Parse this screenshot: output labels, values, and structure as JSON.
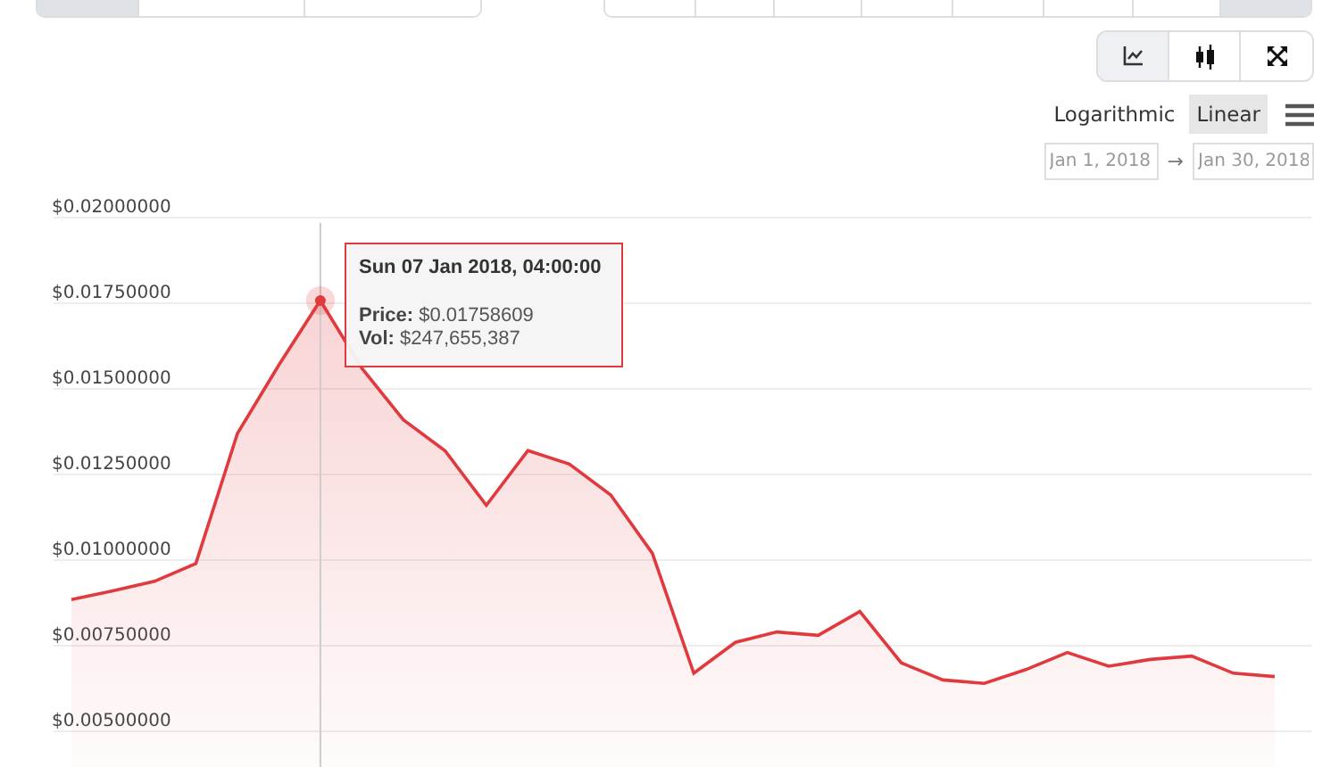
{
  "top_tabs_left": [
    {
      "selected": true
    },
    {
      "selected": false
    },
    {
      "selected": false
    }
  ],
  "top_tabs_right": [
    {
      "selected": false
    },
    {
      "selected": false
    },
    {
      "selected": false
    },
    {
      "selected": false
    },
    {
      "selected": false
    },
    {
      "selected": false
    },
    {
      "selected": false
    },
    {
      "selected": true
    }
  ],
  "chart_type_buttons": [
    {
      "kind": "line",
      "selected": true
    },
    {
      "kind": "candle",
      "selected": false
    },
    {
      "kind": "fullscreen",
      "selected": false
    }
  ],
  "scale_options": [
    {
      "label": "Logarithmic",
      "selected": false
    },
    {
      "label": "Linear",
      "selected": true
    }
  ],
  "date_range": {
    "from": "Jan 1, 2018",
    "separator": "→",
    "to": "Jan 30, 2018"
  },
  "chart_data": {
    "type": "area",
    "grid": true,
    "ylim": [
      0.005,
      0.02
    ],
    "yticks": [
      {
        "value": 0.02,
        "label": "$0.02000000"
      },
      {
        "value": 0.0175,
        "label": "$0.01750000"
      },
      {
        "value": 0.015,
        "label": "$0.01500000"
      },
      {
        "value": 0.0125,
        "label": "$0.01250000"
      },
      {
        "value": 0.01,
        "label": "$0.01000000"
      },
      {
        "value": 0.0075,
        "label": "$0.00750000"
      },
      {
        "value": 0.005,
        "label": "$0.00500000"
      }
    ],
    "series": [
      {
        "color": "#e03a3e",
        "values": [
          0.00885,
          0.0091,
          0.00938,
          0.0099,
          0.0137,
          0.0157,
          0.01758,
          0.0156,
          0.0141,
          0.0132,
          0.0116,
          0.0132,
          0.0128,
          0.0119,
          0.0102,
          0.0067,
          0.0076,
          0.0079,
          0.0078,
          0.0085,
          0.007,
          0.0065,
          0.0064,
          0.0068,
          0.0073,
          0.0069,
          0.0071,
          0.0072,
          0.0067,
          0.0066
        ]
      }
    ]
  },
  "tooltip": {
    "title": "Sun 07 Jan 2018, 04:00:00",
    "rows": [
      {
        "label": "Price:",
        "value": "$0.01758609"
      },
      {
        "label": "Vol:",
        "value": "$247,655,387"
      }
    ]
  }
}
